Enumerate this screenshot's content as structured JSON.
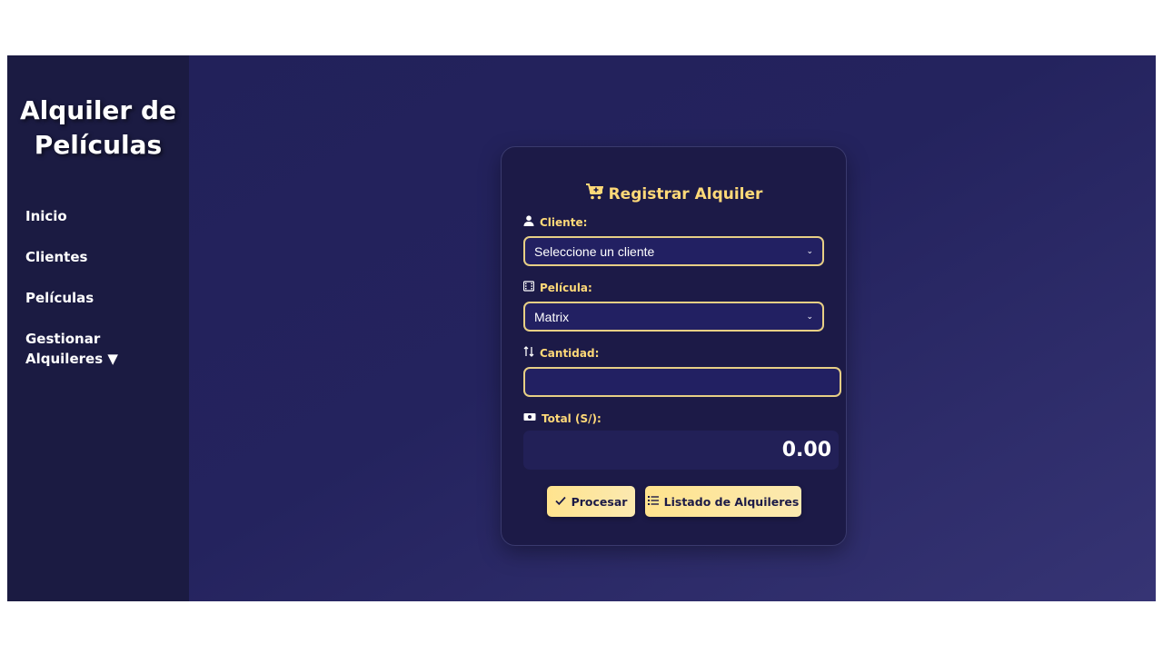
{
  "sidebar": {
    "brand": "Alquiler de Películas",
    "items": [
      {
        "label": "Inicio"
      },
      {
        "label": "Clientes"
      },
      {
        "label": "Películas"
      },
      {
        "label": "Gestionar Alquileres ▼"
      }
    ]
  },
  "form": {
    "title": "Registrar Alquiler",
    "title_icon": "cart-plus-icon",
    "cliente": {
      "label": "Cliente:",
      "icon": "user-icon",
      "selected": "Seleccione un cliente"
    },
    "pelicula": {
      "label": "Película:",
      "icon": "film-icon",
      "selected": "Matrix"
    },
    "cantidad": {
      "label": "Cantidad:",
      "icon": "sort-arrows-icon",
      "value": ""
    },
    "total": {
      "label": "Total (S/):",
      "icon": "money-bill-icon",
      "value": "0.00"
    },
    "buttons": {
      "procesar": "Procesar",
      "listado": "Listado de Alquileres"
    }
  },
  "colors": {
    "sidebar_bg": "#1b1b42",
    "main_bg": "#24235e",
    "accent": "#ffd978",
    "field_border": "#e7cf85"
  }
}
